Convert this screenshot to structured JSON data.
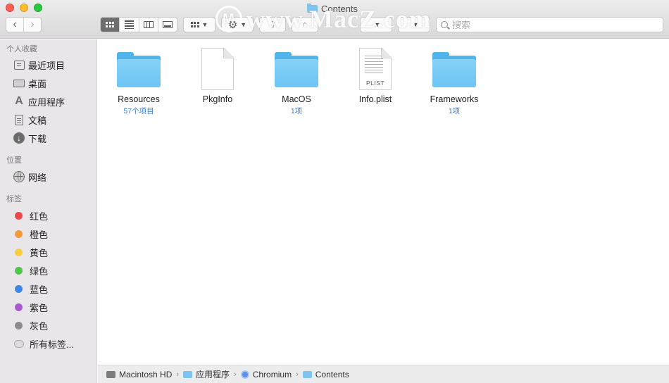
{
  "window": {
    "title": "Contents"
  },
  "watermark": {
    "text": "www.MacZ.com",
    "logo": "M"
  },
  "toolbar": {
    "back_glyph": "‹",
    "forward_glyph": "›",
    "search_placeholder": "搜索",
    "search_value": ""
  },
  "sidebar": {
    "favorites_header": "个人收藏",
    "favorites": [
      {
        "label": "最近项目",
        "icon": "recent-icon"
      },
      {
        "label": "桌面",
        "icon": "desktop-icon"
      },
      {
        "label": "应用程序",
        "icon": "applications-icon"
      },
      {
        "label": "文稿",
        "icon": "document-icon"
      },
      {
        "label": "下载",
        "icon": "download-icon"
      }
    ],
    "locations_header": "位置",
    "locations": [
      {
        "label": "网络",
        "icon": "network-icon"
      }
    ],
    "tags_header": "标签",
    "tags": [
      {
        "label": "红色",
        "color": "#f0474a"
      },
      {
        "label": "橙色",
        "color": "#f49a38"
      },
      {
        "label": "黄色",
        "color": "#f8cf3b"
      },
      {
        "label": "绿色",
        "color": "#4ec64a"
      },
      {
        "label": "蓝色",
        "color": "#3b86e6"
      },
      {
        "label": "紫色",
        "color": "#a85bd0"
      },
      {
        "label": "灰色",
        "color": "#8c8c8c"
      },
      {
        "label": "所有标签...",
        "color": ""
      }
    ]
  },
  "files": [
    {
      "name": "Resources",
      "sub": "57个项目",
      "kind": "folder"
    },
    {
      "name": "PkgInfo",
      "sub": "",
      "kind": "document"
    },
    {
      "name": "MacOS",
      "sub": "1项",
      "kind": "folder"
    },
    {
      "name": "Info.plist",
      "sub": "",
      "kind": "plist",
      "badge": "PLIST"
    },
    {
      "name": "Frameworks",
      "sub": "1项",
      "kind": "folder"
    }
  ],
  "pathbar": [
    {
      "label": "Macintosh HD",
      "icon": "hard-drive-icon"
    },
    {
      "label": "应用程序",
      "icon": "applications-folder-icon"
    },
    {
      "label": "Chromium",
      "icon": "chromium-icon"
    },
    {
      "label": "Contents",
      "icon": "folder-icon"
    }
  ],
  "pathbar_separator": "›"
}
